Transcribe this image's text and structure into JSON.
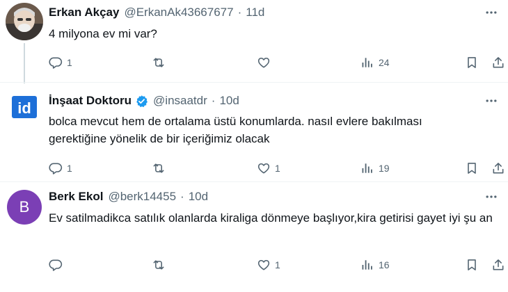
{
  "tweets": [
    {
      "name": "Erkan Akçay",
      "handle": "@ErkanAk43667677",
      "time": "11d",
      "text": "4 milyona ev mi var?",
      "replies": "1",
      "retweets": "",
      "likes": "",
      "views": "24"
    },
    {
      "name": "İnşaat Doktoru",
      "handle": "@insaatdr",
      "time": "10d",
      "verified": true,
      "avatar_text": "id",
      "avatar_color": "#1d6fd8",
      "text": "bolca mevcut hem de ortalama üstü konumlarda. nasıl evlere bakılması gerektiğine yönelik de bir içeriğimiz olacak",
      "replies": "1",
      "retweets": "",
      "likes": "1",
      "views": "19"
    },
    {
      "name": "Berk Ekol",
      "handle": "@berk14455",
      "time": "10d",
      "avatar_text": "B",
      "avatar_color": "#7b3fb5",
      "text": "Ev satilmadikca satılık olanlarda kiraliga dönmeye başlıyor,kira getirisi gayet iyi şu an",
      "replies": "",
      "retweets": "",
      "likes": "1",
      "views": "16"
    }
  ],
  "separator": "·",
  "colors": {
    "verified": "#1d9bf0",
    "text_secondary": "#536471",
    "divider": "#eff3f4"
  },
  "icons": [
    "more-icon",
    "reply-icon",
    "retweet-icon",
    "like-icon",
    "views-icon",
    "bookmark-icon",
    "share-icon",
    "verified-badge-icon"
  ]
}
